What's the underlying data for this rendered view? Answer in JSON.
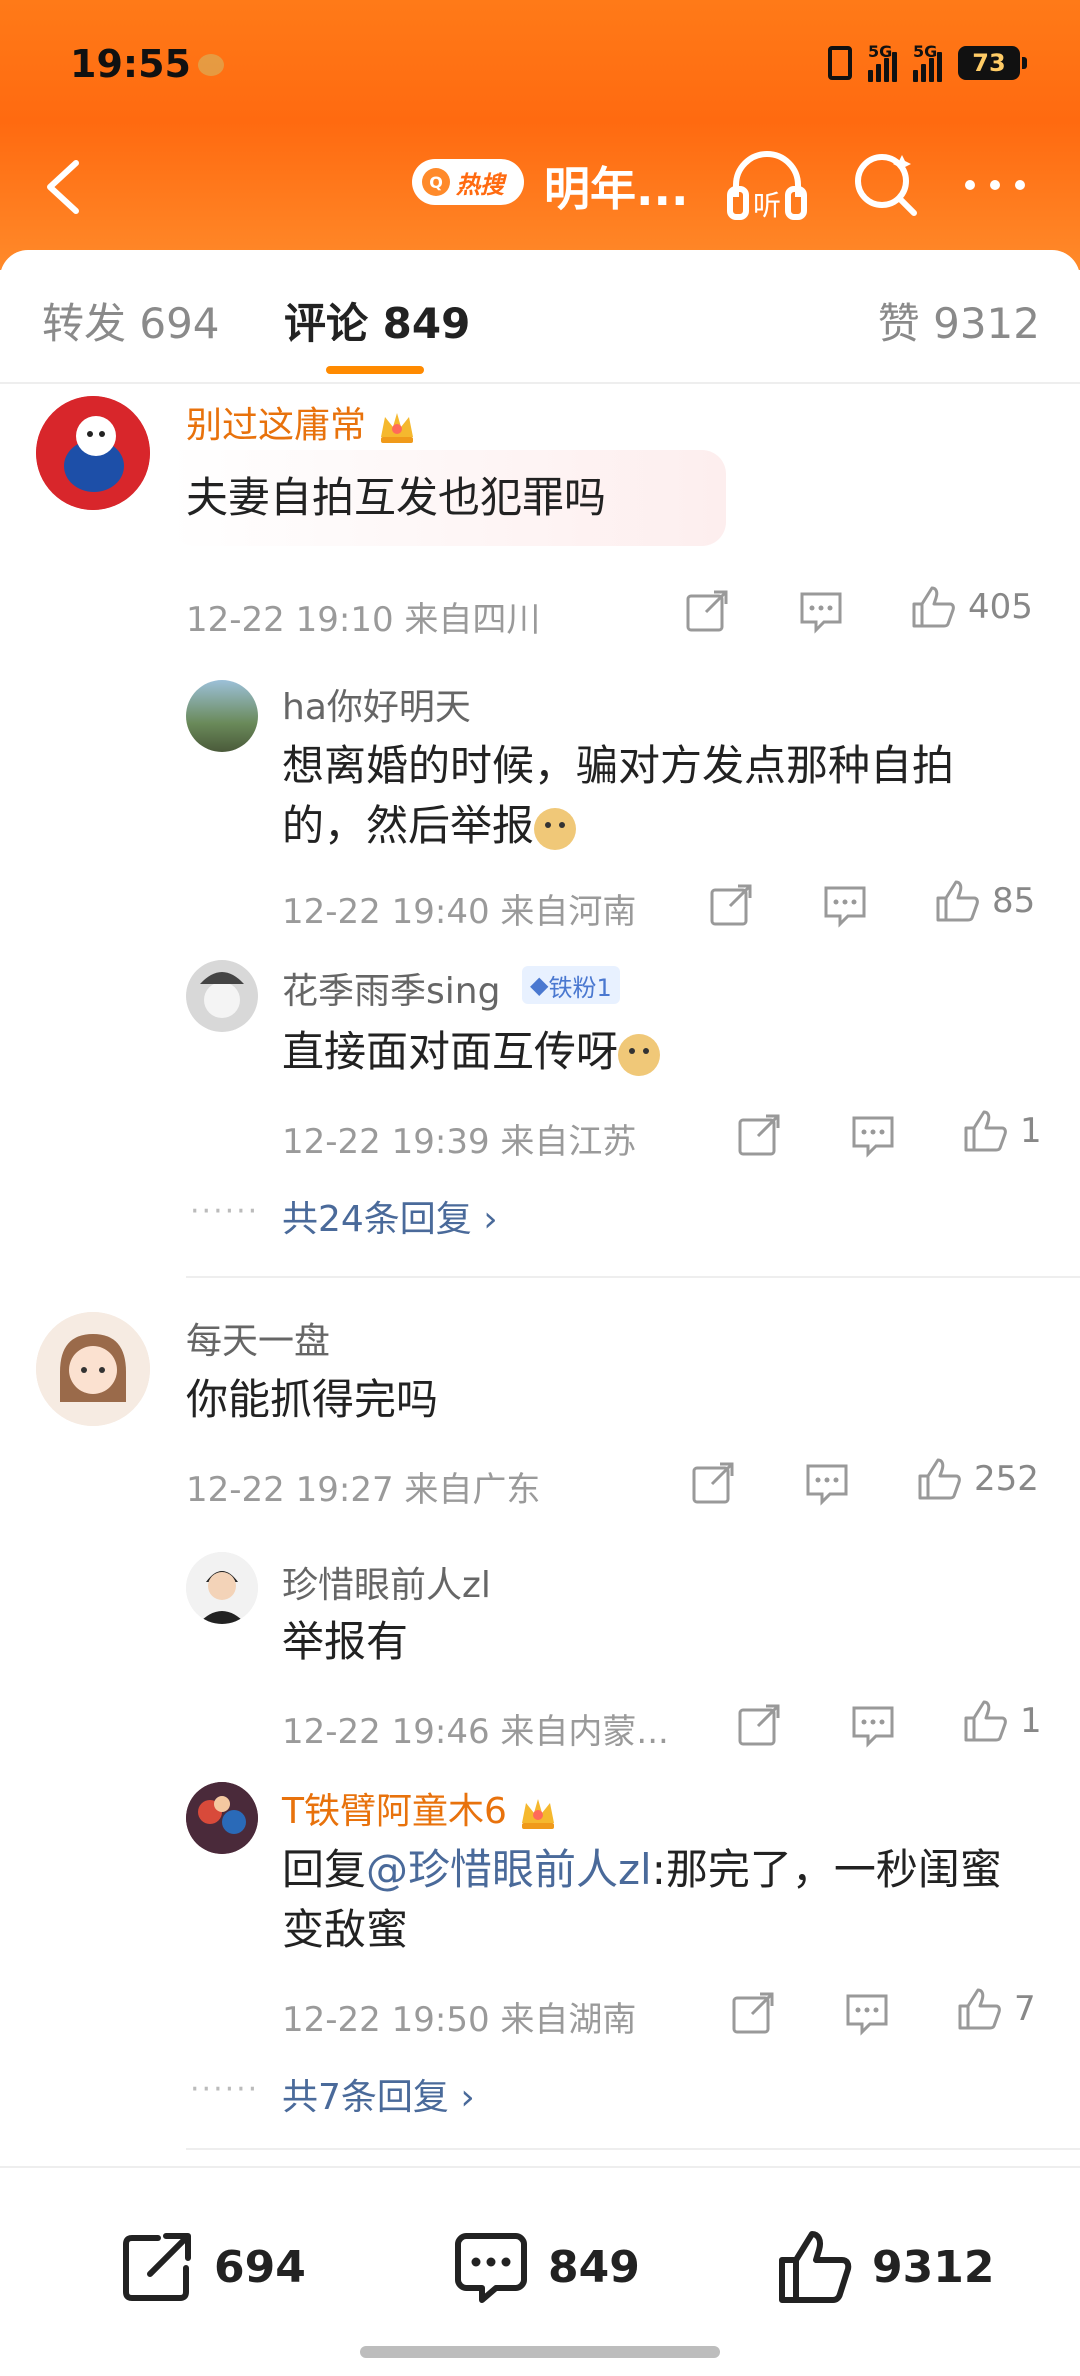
{
  "status": {
    "time": "19:55",
    "sig1": "5G",
    "sig2": "5G",
    "battery": "73"
  },
  "nav": {
    "hot_badge": "热搜",
    "title": "明年..."
  },
  "tabs": {
    "repost": "转发 694",
    "comment": "评论 849",
    "like": "赞 9312"
  },
  "comments": [
    {
      "user": "别过这庸常",
      "text": "夫妻自拍互发也犯罪吗",
      "meta": "12-22 19:10  来自四川",
      "likes": "405",
      "replies": [
        {
          "user": "ha你好明天",
          "text_line1": "想离婚的时候，骗对方发点那种自拍",
          "text_line2": "的，然后举报",
          "meta": "12-22 19:40  来自河南",
          "likes": "85"
        },
        {
          "user": "花季雨季sing",
          "badge": "铁粉1",
          "text": "直接面对面互传呀",
          "meta": "12-22 19:39  来自江苏",
          "likes": "1"
        }
      ],
      "more_replies": "共24条回复 ›"
    },
    {
      "user": "每天一盘",
      "text": "你能抓得完吗",
      "meta": "12-22 19:27  来自广东",
      "likes": "252",
      "replies": [
        {
          "user": "珍惜眼前人zl",
          "text": "举报有",
          "meta": "12-22 19:46  来自内蒙...",
          "likes": "1"
        },
        {
          "user": "T铁臂阿童木6",
          "text_prefix": "回复",
          "mention": "@珍惜眼前人zl",
          "text_rest": ":那完了，一秒闺蜜",
          "text_line2": "变敌蜜",
          "meta": "12-22 19:50  来自湖南",
          "likes": "7"
        }
      ],
      "more_replies": "共7条回复 ›"
    }
  ],
  "dots": "······",
  "bottom": {
    "repost": "694",
    "comment": "849",
    "like": "9312"
  },
  "colors": {
    "header": "#ff7a18",
    "accent": "#ff8a00",
    "link": "#4a6a9a",
    "vip_name": "#e8720c"
  },
  "icons": [
    "back-icon",
    "search-icon",
    "listen-icon",
    "more-icon",
    "share-icon",
    "comment-icon",
    "like-icon",
    "crown-icon",
    "doge-emoji-icon"
  ]
}
